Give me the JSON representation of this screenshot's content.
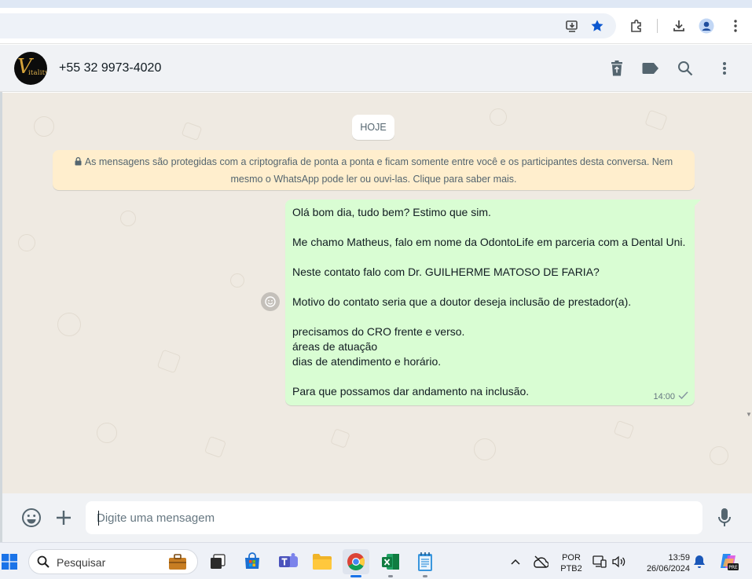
{
  "browser": {
    "icons": [
      "install-app-icon",
      "bookmark-star-icon",
      "extensions-icon",
      "downloads-icon",
      "profile-icon",
      "more-vert-icon"
    ],
    "accent": "#0b57d0"
  },
  "header": {
    "avatar_text": "itality",
    "avatar_initial": "V",
    "contact": "+55 32 9973-4020",
    "icons": [
      "delete-icon",
      "label-icon",
      "search-icon",
      "menu-icon"
    ]
  },
  "chat": {
    "date_chip": "HOJE",
    "encryption_notice_line1": "As mensagens são protegidas com a criptografia de ponta a ponta e ficam somente entre você e os participantes desta conversa. Nem",
    "encryption_notice_line2": "mesmo o WhatsApp pode ler ou ouvi-las. Clique para saber mais.",
    "message": {
      "lines": [
        "Olá bom dia, tudo bem? Estimo que sim.",
        "",
        "Me chamo Matheus, falo em nome da OdontoLife em parceria com a Dental Uni.",
        "",
        "Neste contato falo com Dr. GUILHERME MATOSO DE FARIA?",
        "",
        "Motivo do contato seria que a doutor deseja inclusão de prestador(a).",
        "",
        "precisamos do CRO frente e verso.",
        "áreas de atuação",
        "dias de atendimento e horário.",
        "",
        "Para que possamos dar andamento na inclusão."
      ],
      "time": "14:00",
      "status": "sent"
    },
    "bubble_color": "#d9fdd3",
    "background_color": "#efeae2"
  },
  "composer": {
    "placeholder": "Digite uma mensagem",
    "value": "",
    "icons": [
      "emoji-icon",
      "attach-plus-icon",
      "microphone-icon"
    ]
  },
  "taskbar": {
    "search_label": "Pesquisar",
    "apps": [
      "file-explorer-briefcase-icon",
      "task-view-icon",
      "microsoft-store-icon",
      "teams-icon",
      "folder-icon",
      "chrome-icon",
      "excel-icon",
      "notepad-icon"
    ],
    "language_line1": "POR",
    "language_line2": "PTB2",
    "time": "13:59",
    "date": "26/06/2024"
  }
}
